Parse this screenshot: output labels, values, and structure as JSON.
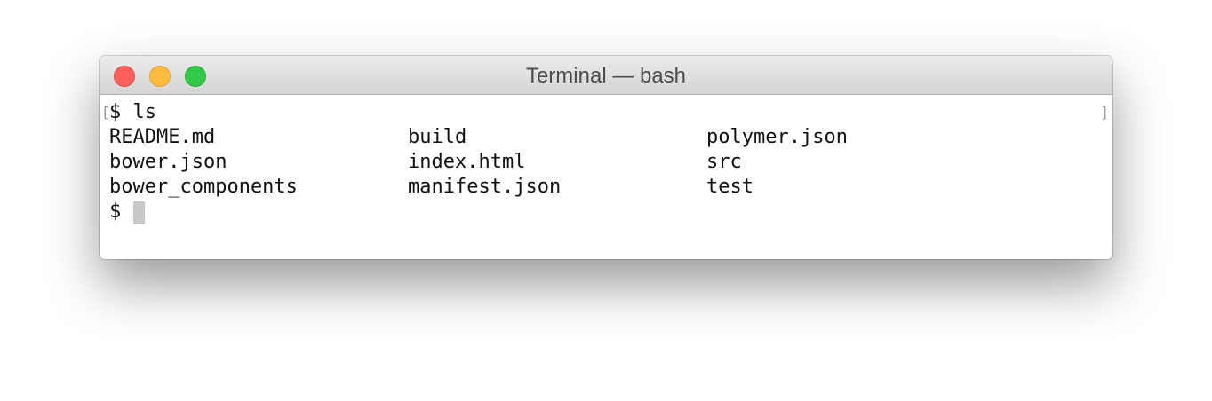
{
  "window": {
    "title": "Terminal — bash"
  },
  "terminal": {
    "bracket_left": "[",
    "bracket_right": "]",
    "command_line": "$ ls",
    "listing": [
      [
        "README.md",
        "build",
        "polymer.json"
      ],
      [
        "bower.json",
        "index.html",
        "src"
      ],
      [
        "bower_components",
        "manifest.json",
        "test"
      ]
    ],
    "prompt": "$"
  },
  "colors": {
    "close": "#fc605c",
    "minimize": "#fdbc40",
    "zoom": "#34c84a",
    "cursor": "#c8c8c8"
  }
}
